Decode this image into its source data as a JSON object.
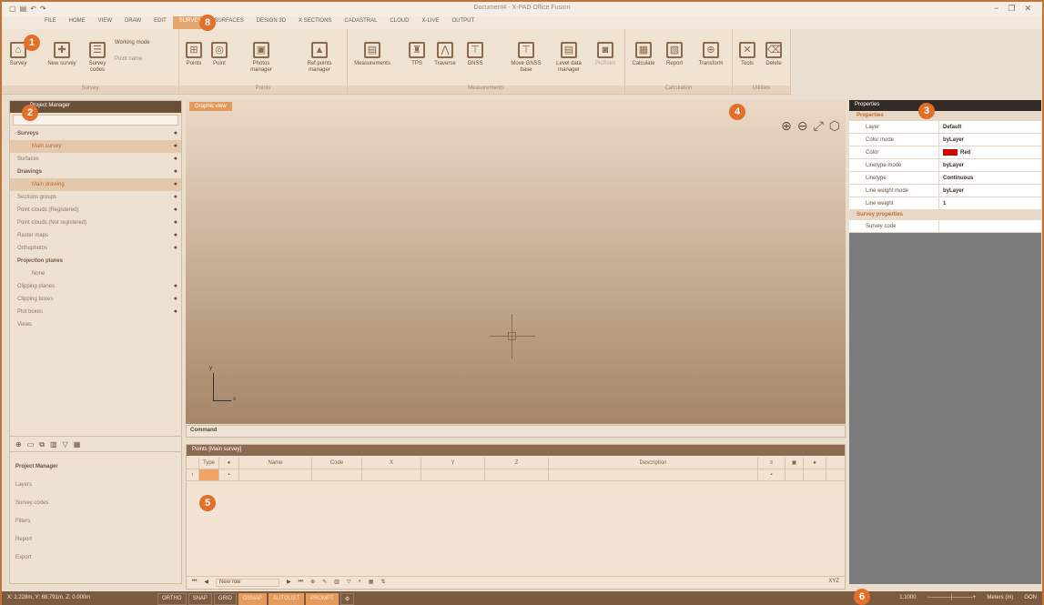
{
  "window": {
    "title": "Document4 - X-PAD Office Fusion",
    "minimize": "−",
    "restore": "❐",
    "close": "✕"
  },
  "menu": {
    "tabs": [
      {
        "label": "FILE"
      },
      {
        "label": "HOME"
      },
      {
        "label": "VIEW"
      },
      {
        "label": "DRAW"
      },
      {
        "label": "EDIT"
      },
      {
        "label": "SURVEY",
        "active": true
      },
      {
        "label": "SURFACES"
      },
      {
        "label": "DESIGN 3D"
      },
      {
        "label": "X SECTIONS"
      },
      {
        "label": "CADASTRAL"
      },
      {
        "label": "CLOUD"
      },
      {
        "label": "X-LIVE"
      },
      {
        "label": "OUTPUT"
      }
    ]
  },
  "ribbon": {
    "groups": {
      "survey": "Survey",
      "points": "Points",
      "measurements": "Measurements",
      "calculation": "Calculation",
      "utilities": "Utilities"
    },
    "buttons": {
      "survey": "Survey",
      "new_survey": "New survey",
      "survey_codes": "Survey codes",
      "working_mode": "Working mode",
      "point_name": "Point name",
      "points": "Points",
      "point": "Point",
      "photos_manager": "Photos manager",
      "ref_points": "Ref.points manager",
      "measurements": "Measurements",
      "tps": "TPS",
      "traverse": "Traverse",
      "gnss": "GNSS",
      "move_gnss": "Move GNSS base",
      "level_data": "Level data manager",
      "picpoint": "PicPoint",
      "calculate": "Calculate",
      "report": "Report",
      "transform": "Transform",
      "tools": "Tools",
      "delete": "Delete"
    }
  },
  "project_manager": {
    "title": "Project Manager",
    "tree": [
      {
        "label": "Surveys",
        "bold": true
      },
      {
        "label": "Main survey",
        "selected": true
      },
      {
        "label": "Surfaces"
      },
      {
        "label": "Drawings",
        "bold": true
      },
      {
        "label": "Main drawing",
        "selected": true
      },
      {
        "label": "Sections groups"
      },
      {
        "label": "Point clouds (Registered)"
      },
      {
        "label": "Point clouds (Not registered)"
      },
      {
        "label": "Raster maps"
      },
      {
        "label": "Orthophotos"
      },
      {
        "label": "Projection planes",
        "bold": true
      },
      {
        "label": "None"
      },
      {
        "label": "Clipping planes"
      },
      {
        "label": "Clipping boxes"
      },
      {
        "label": "Plot boxes"
      },
      {
        "label": "Views"
      }
    ],
    "bottom": [
      {
        "label": "Project Manager",
        "bold": true
      },
      {
        "label": "Layers"
      },
      {
        "label": "Survey codes"
      },
      {
        "label": "Filters"
      },
      {
        "label": "Report"
      },
      {
        "label": "Export"
      }
    ]
  },
  "graphic_view": {
    "tab": "Graphic view",
    "axis_x": "x",
    "axis_y": "y"
  },
  "command": {
    "label": "Command"
  },
  "points_panel": {
    "title": "Points [Main survey]",
    "columns": [
      "Type",
      "Name",
      "Code",
      "X",
      "Y",
      "Z",
      "Description"
    ],
    "new_row": "New row",
    "coord_label": "XYZ"
  },
  "properties": {
    "title": "Properties",
    "section1": "Properties",
    "rows": [
      {
        "key": "Layer",
        "value": "Default"
      },
      {
        "key": "Color mode",
        "value": "byLayer"
      },
      {
        "key": "Color",
        "value": "Red"
      },
      {
        "key": "Linetype mode",
        "value": "byLayer"
      },
      {
        "key": "Linetype",
        "value": "Continuous"
      },
      {
        "key": "Line weight mode",
        "value": "byLayer"
      },
      {
        "key": "Line weight",
        "value": "1"
      }
    ],
    "section2": "Survey properties",
    "rows2": [
      {
        "key": "Survey code",
        "value": ""
      }
    ],
    "colors": {
      "red": "#d40000"
    }
  },
  "status_bar": {
    "coords": "X: 2.228m, Y: 68.791m, Z: 0.000m",
    "modes": [
      {
        "label": "ORTHO"
      },
      {
        "label": "SNAP"
      },
      {
        "label": "GRID"
      },
      {
        "label": "OSNAP",
        "on": true
      },
      {
        "label": "AUTOLIST",
        "on": true
      },
      {
        "label": "PROMPT",
        "on": true
      }
    ],
    "scale": "1:1000",
    "units": "Meters (m)",
    "angle": "GON"
  },
  "badges": [
    "1",
    "2",
    "3",
    "4",
    "5",
    "6",
    "8"
  ]
}
